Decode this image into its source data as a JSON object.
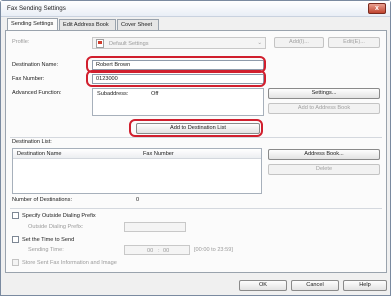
{
  "window": {
    "title": "Fax Sending Settings",
    "close_glyph": "x"
  },
  "tabs": [
    {
      "label": "Sending Settings"
    },
    {
      "label": "Edit Address Book"
    },
    {
      "label": "Cover Sheet"
    }
  ],
  "profile": {
    "label": "Profile:",
    "value": "Default Settings",
    "add_button": "Add(I)...",
    "edit_button": "Edit(E)..."
  },
  "destination": {
    "name_label": "Destination Name:",
    "name_value": "Robert Brown",
    "number_label": "Fax Number:",
    "number_value": "0123000",
    "advanced_label": "Advanced Function:",
    "subaddress_label": "Subaddress:",
    "subaddress_value": "Off",
    "settings_button": "Settings...",
    "add_to_address_book_button": "Add to Address Book",
    "add_to_list_button": "Add to Destination List"
  },
  "destination_list": {
    "label": "Destination List:",
    "columns": [
      "Destination Name",
      "Fax Number"
    ],
    "rows": [],
    "address_book_button": "Address Book...",
    "delete_button": "Delete",
    "count_label": "Number of Destinations:",
    "count_value": "0"
  },
  "options": {
    "outside_prefix_check": "Specify Outside Dialing Prefix",
    "outside_prefix_label": "Outside Dialing Prefix:",
    "outside_prefix_value": "",
    "set_time_check": "Set the Time to Send",
    "sending_time_label": "Sending Time:",
    "hour": "00",
    "separator": ":",
    "minute": "00",
    "time_range": "[00:00 to 23:59]",
    "store_check": "Store Sent Fax Information and Image"
  },
  "footer": {
    "ok": "OK",
    "cancel": "Cancel",
    "help": "Help"
  },
  "colors": {
    "highlight": "#d11f2e",
    "window_border": "#7a8aa0"
  }
}
